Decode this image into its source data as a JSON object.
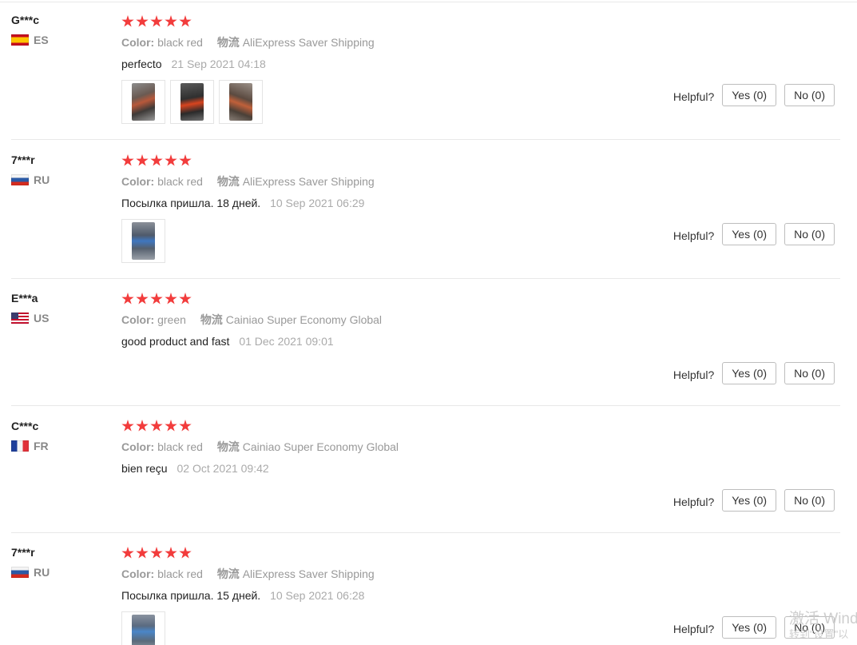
{
  "helpful_label": "Helpful?",
  "reviews": [
    {
      "user": "G***c",
      "country": "ES",
      "rating": 5,
      "color_label": "Color:",
      "color_value": "black red",
      "shipping_label": "物流",
      "shipping_value": "AliExpress Saver Shipping",
      "comment": "perfecto",
      "date": "21 Sep 2021 04:18",
      "photo_count": 3,
      "yes": "Yes (0)",
      "no": "No (0)"
    },
    {
      "user": "7***r",
      "country": "RU",
      "rating": 5,
      "color_label": "Color:",
      "color_value": "black red",
      "shipping_label": "物流",
      "shipping_value": "AliExpress Saver Shipping",
      "comment": "Посылка пришла. 18 дней.",
      "date": "10 Sep 2021 06:29",
      "photo_count": 1,
      "yes": "Yes (0)",
      "no": "No (0)"
    },
    {
      "user": "E***a",
      "country": "US",
      "rating": 5,
      "color_label": "Color:",
      "color_value": "green",
      "shipping_label": "物流",
      "shipping_value": "Cainiao Super Economy Global",
      "comment": "good product and fast",
      "date": "01 Dec 2021 09:01",
      "photo_count": 0,
      "yes": "Yes (0)",
      "no": "No (0)"
    },
    {
      "user": "C***c",
      "country": "FR",
      "rating": 5,
      "color_label": "Color:",
      "color_value": "black red",
      "shipping_label": "物流",
      "shipping_value": "Cainiao Super Economy Global",
      "comment": "bien reçu",
      "date": "02 Oct 2021 09:42",
      "photo_count": 0,
      "yes": "Yes (0)",
      "no": "No (0)"
    },
    {
      "user": "7***r",
      "country": "RU",
      "rating": 5,
      "color_label": "Color:",
      "color_value": "black red",
      "shipping_label": "物流",
      "shipping_value": "AliExpress Saver Shipping",
      "comment": "Посылка пришла. 15 дней.",
      "date": "10 Sep 2021 06:28",
      "photo_count": 1,
      "yes": "Yes (0)",
      "no": "No (0)"
    }
  ],
  "watermark": {
    "line1": "激活 Wind",
    "line2": "转到\"设置\"以"
  },
  "colors": {
    "star": "#f23c3c",
    "muted_text": "#999999",
    "separator": "#e8e8e8"
  }
}
